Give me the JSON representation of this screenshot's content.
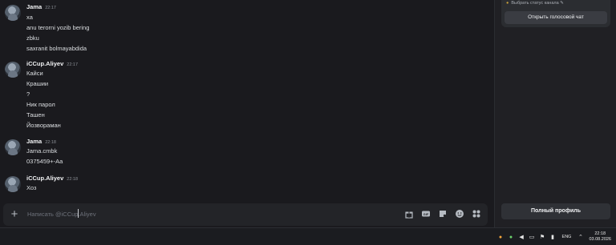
{
  "messages": [
    {
      "author": "Jama",
      "time": "22:17",
      "lines": [
        "xa",
        "anu terorni yozib bering",
        "zbku",
        "saxranit bolmayabdida"
      ]
    },
    {
      "author": "iCCup.Aliyev",
      "time": "22:17",
      "lines": [
        "Кайси",
        "Крашии",
        "?",
        "Ник парол",
        "Ташен",
        "Йозвораман"
      ]
    },
    {
      "author": "Jama",
      "time": "22:18",
      "lines": [
        "Jama.cmbk",
        "0375459+-Aa"
      ]
    },
    {
      "author": "iCCup.Aliyev",
      "time": "22:18",
      "lines": [
        "Хоз"
      ]
    }
  ],
  "composer": {
    "plus_icon": "plus-icon",
    "placeholder": "Написать @iCCup.Aliyev",
    "tools": [
      "gift-icon",
      "gif-icon",
      "sticker-icon",
      "emoji-icon",
      "apps-icon"
    ]
  },
  "sidebar": {
    "status_text": "Выбрать статус канала",
    "voice_chat_button": "Открыть голосовой чат",
    "full_profile_button": "Полный профиль"
  },
  "taskbar": {
    "language": "ENG",
    "time": "22:18",
    "date": "03.08.2026"
  },
  "colors": {
    "background": "#1a1a1e",
    "sidebar": "#202024",
    "composer": "#232428",
    "text": "#dbdee1"
  }
}
